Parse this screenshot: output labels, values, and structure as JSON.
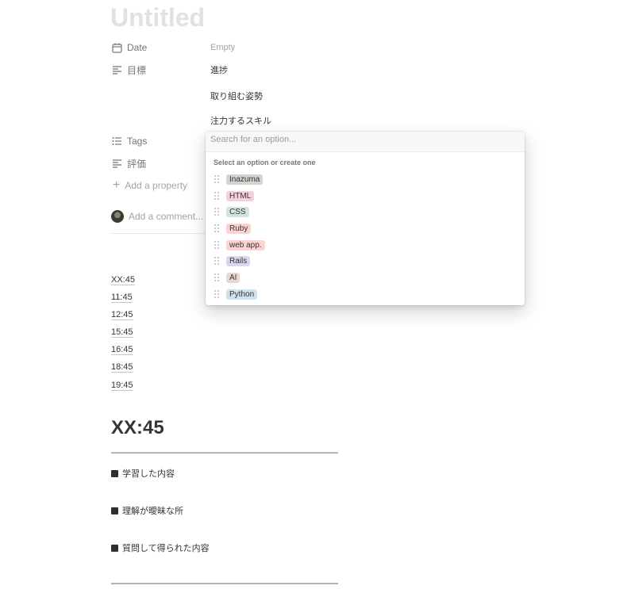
{
  "page": {
    "title": "Untitled"
  },
  "properties": {
    "date": {
      "label": "Date",
      "value": "Empty",
      "icon": "calendar-icon"
    },
    "goal": {
      "label": "目標",
      "values": [
        "進捗",
        "取り組む姿勢",
        "注力するスキル"
      ],
      "icon": "text-lines-icon"
    },
    "tags": {
      "label": "Tags",
      "icon": "list-icon"
    },
    "rating": {
      "label": "評価",
      "icon": "text-lines-icon"
    },
    "add_property": "Add a property",
    "comment_placeholder": "Add a comment..."
  },
  "toc": [
    "XX:45",
    "11:45",
    "12:45",
    "15:45",
    "16:45",
    "18:45",
    "19:45"
  ],
  "content": {
    "heading": "XX:45",
    "dashes": "——————————————————————————",
    "items": [
      "学習した内容",
      "理解が曖昧な所",
      "質問して得られた内容"
    ]
  },
  "dropdown": {
    "search_placeholder": "Search for an option...",
    "hint": "Select an option or create one",
    "options": [
      {
        "label": "Inazuma",
        "color": "#d3d3d0"
      },
      {
        "label": "HTML",
        "color": "#f5d0dc"
      },
      {
        "label": "CSS",
        "color": "#d0e4e0"
      },
      {
        "label": "Ruby",
        "color": "#fbd4d2"
      },
      {
        "label": "web app.",
        "color": "#fbd4d2"
      },
      {
        "label": "Rails",
        "color": "#ddd6ef"
      },
      {
        "label": "AI",
        "color": "#ecd6d1"
      },
      {
        "label": "Python",
        "color": "#d0e1ee"
      }
    ]
  }
}
